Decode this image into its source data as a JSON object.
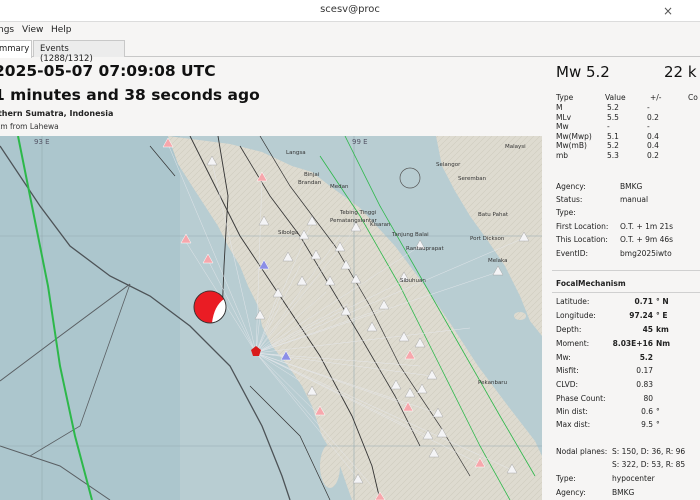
{
  "window": {
    "title": "scesv@proc",
    "close_symbol": "×"
  },
  "menu": {
    "items": [
      "ngs",
      "View",
      "Help"
    ]
  },
  "tabs": [
    {
      "label": "mmary",
      "active": true
    },
    {
      "label": "Events (1288/1312)",
      "active": false
    }
  ],
  "event": {
    "origin_time": "2025-05-07 07:09:08 UTC",
    "elapsed": "1 minutes and 38 seconds ago",
    "region": "rthern Sumatra, Indonesia",
    "distance": "km from Lahewa",
    "magnitude": "Mw 5.2",
    "depth": "22 k"
  },
  "magnitudes": {
    "headers": [
      "Type",
      "Value",
      "+/-",
      "Co"
    ],
    "rows": [
      [
        "M",
        "5.2",
        "-"
      ],
      [
        "MLv",
        "5.5",
        "0.2"
      ],
      [
        "Mw",
        "-",
        "-"
      ],
      [
        "Mw(Mwp)",
        "5.1",
        "0.4"
      ],
      [
        "Mw(mB)",
        "5.2",
        "0.4"
      ],
      [
        "mb",
        "5.3",
        "0.2"
      ]
    ]
  },
  "info": {
    "rows": [
      {
        "label": "Agency:",
        "value": "BMKG"
      },
      {
        "label": "Status:",
        "value": "manual"
      },
      {
        "label": "Type:",
        "value": ""
      },
      {
        "label": "First Location:",
        "value": "O.T. + 1m 21s"
      },
      {
        "label": "This Location:",
        "value": "O.T. + 9m 46s"
      },
      {
        "label": "EventID:",
        "value": "bmg2025iwto"
      }
    ]
  },
  "focal": {
    "title": "FocalMechanism",
    "rows": [
      {
        "label": "Latitude:",
        "value": "0.71",
        "unit": "° N",
        "bold": true
      },
      {
        "label": "Longitude:",
        "value": "97.24",
        "unit": "° E",
        "bold": true
      },
      {
        "label": "Depth:",
        "value": "45",
        "unit": "km",
        "bold": true
      },
      {
        "label": "Moment:",
        "value": "8.03E+16",
        "unit": "Nm",
        "bold": true
      },
      {
        "label": "Mw:",
        "value": "5.2",
        "unit": "",
        "bold": true
      },
      {
        "label": "Misfit:",
        "value": "0.17",
        "unit": "",
        "bold": false
      },
      {
        "label": "CLVD:",
        "value": "0.83",
        "unit": "",
        "bold": false
      },
      {
        "label": "Phase Count:",
        "value": "80",
        "unit": "",
        "bold": false
      },
      {
        "label": "Min dist:",
        "value": "0.6",
        "unit": "°",
        "bold": false
      },
      {
        "label": "Max dist:",
        "value": "9.5",
        "unit": "°",
        "bold": false
      }
    ],
    "nodal_label": "Nodal planes:",
    "nodal_1": "S: 150, D: 36, R: 96",
    "nodal_2": "S: 322, D: 53, R: 85",
    "type_label": "Type:",
    "type_value": "hypocenter",
    "agency_label": "Agency:",
    "agency_value": "BMKG"
  },
  "map": {
    "grid_labels": [
      "93 E",
      "99 E"
    ],
    "places": [
      "Langsa",
      "Binjai",
      "Brandan",
      "Medan",
      "Sibolga",
      "Tebing Tinggi",
      "Pematangsiantar",
      "Kisaran",
      "Tanjung Balai",
      "Rantauprapat",
      "Sibuhuan",
      "Pekanbaru",
      "Malaysi",
      "Melaka",
      "Seremban",
      "Batu Pahat",
      "Selangor",
      "Port Dickson"
    ],
    "colors": {
      "sea": "#b8cdd2",
      "land": "#e4e1d6",
      "plate": "#6a6f73",
      "tsunami": "#2db84a",
      "station_up": "#f4f4f6",
      "station_alert": "#f7a7ac",
      "station_blue": "#8b8ee6",
      "beachball": "#ea1c24",
      "epicenter": "#d91b1b"
    }
  }
}
